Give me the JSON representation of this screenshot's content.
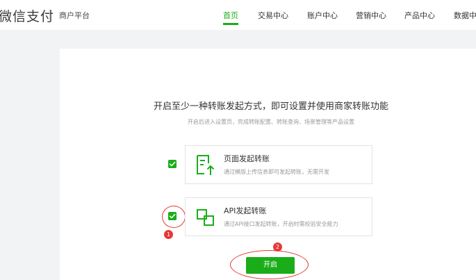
{
  "header": {
    "brand": "微信支付",
    "subbrand": "商户平台",
    "nav": [
      {
        "label": "首页",
        "active": true
      },
      {
        "label": "交易中心",
        "active": false
      },
      {
        "label": "账户中心",
        "active": false
      },
      {
        "label": "营销中心",
        "active": false
      },
      {
        "label": "产品中心",
        "active": false
      },
      {
        "label": "数据中心",
        "active": false
      }
    ]
  },
  "main": {
    "heading": "开启至少一种转账发起方式，即可设置并使用商家转账功能",
    "subheading": "开启后进入设置页，完成转账配置、转账查询、场景管理等产品设置",
    "options": [
      {
        "title": "页面发起转账",
        "desc": "通过模版上传信息即可发起转账，无需开发",
        "checked": true,
        "icon": "document-upload-icon"
      },
      {
        "title": "API发起转账",
        "desc": "通过API接口发起转账，开启时需校验安全能力",
        "checked": true,
        "icon": "api-link-icon"
      }
    ],
    "start_label": "开启"
  },
  "annotations": [
    "1",
    "2"
  ],
  "colors": {
    "accent": "#1aad19",
    "annotation": "#e53935"
  }
}
